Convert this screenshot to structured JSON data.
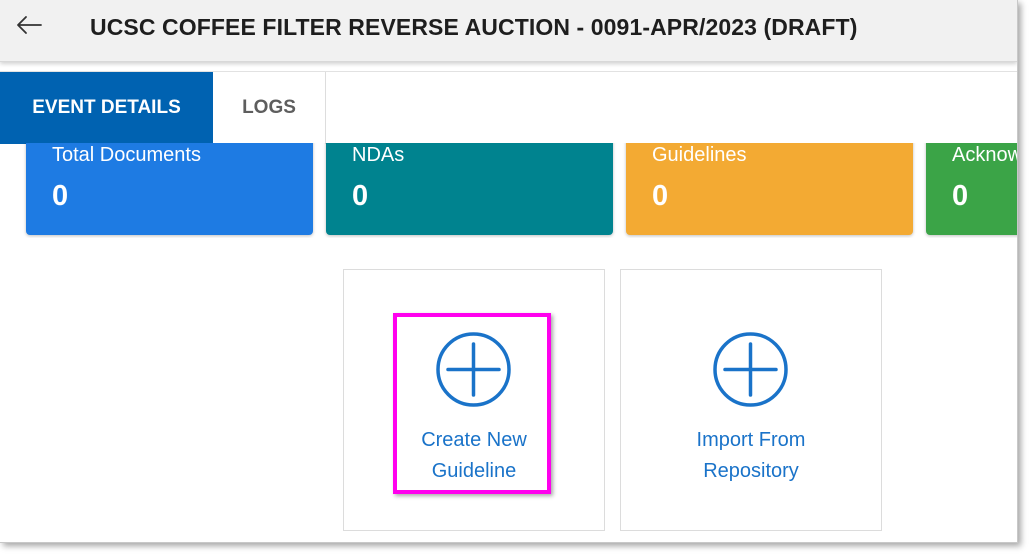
{
  "header": {
    "title": "UCSC COFFEE FILTER REVERSE AUCTION - 0091-APR/2023 (DRAFT)",
    "back_icon": "arrow-left-icon"
  },
  "tabs": [
    {
      "label": "EVENT DETAILS",
      "active": true
    },
    {
      "label": "LOGS",
      "active": false
    }
  ],
  "summary_cards": [
    {
      "label": "Total Documents",
      "value": "0",
      "color": "#1e7be3"
    },
    {
      "label": "NDAs",
      "value": "0",
      "color": "#00838f"
    },
    {
      "label": "Guidelines",
      "value": "0",
      "color": "#f3aa33"
    },
    {
      "label": "Acknow",
      "value": "0",
      "color": "#3ba447"
    }
  ],
  "actions": [
    {
      "line1": "Create New",
      "line2": "Guideline",
      "icon": "plus-circle-icon",
      "highlighted": true
    },
    {
      "line1": "Import From",
      "line2": "Repository",
      "icon": "plus-circle-icon",
      "highlighted": false
    }
  ],
  "colors": {
    "accent": "#0062b1",
    "link": "#1a73c9",
    "highlight": "#ff00ee"
  }
}
